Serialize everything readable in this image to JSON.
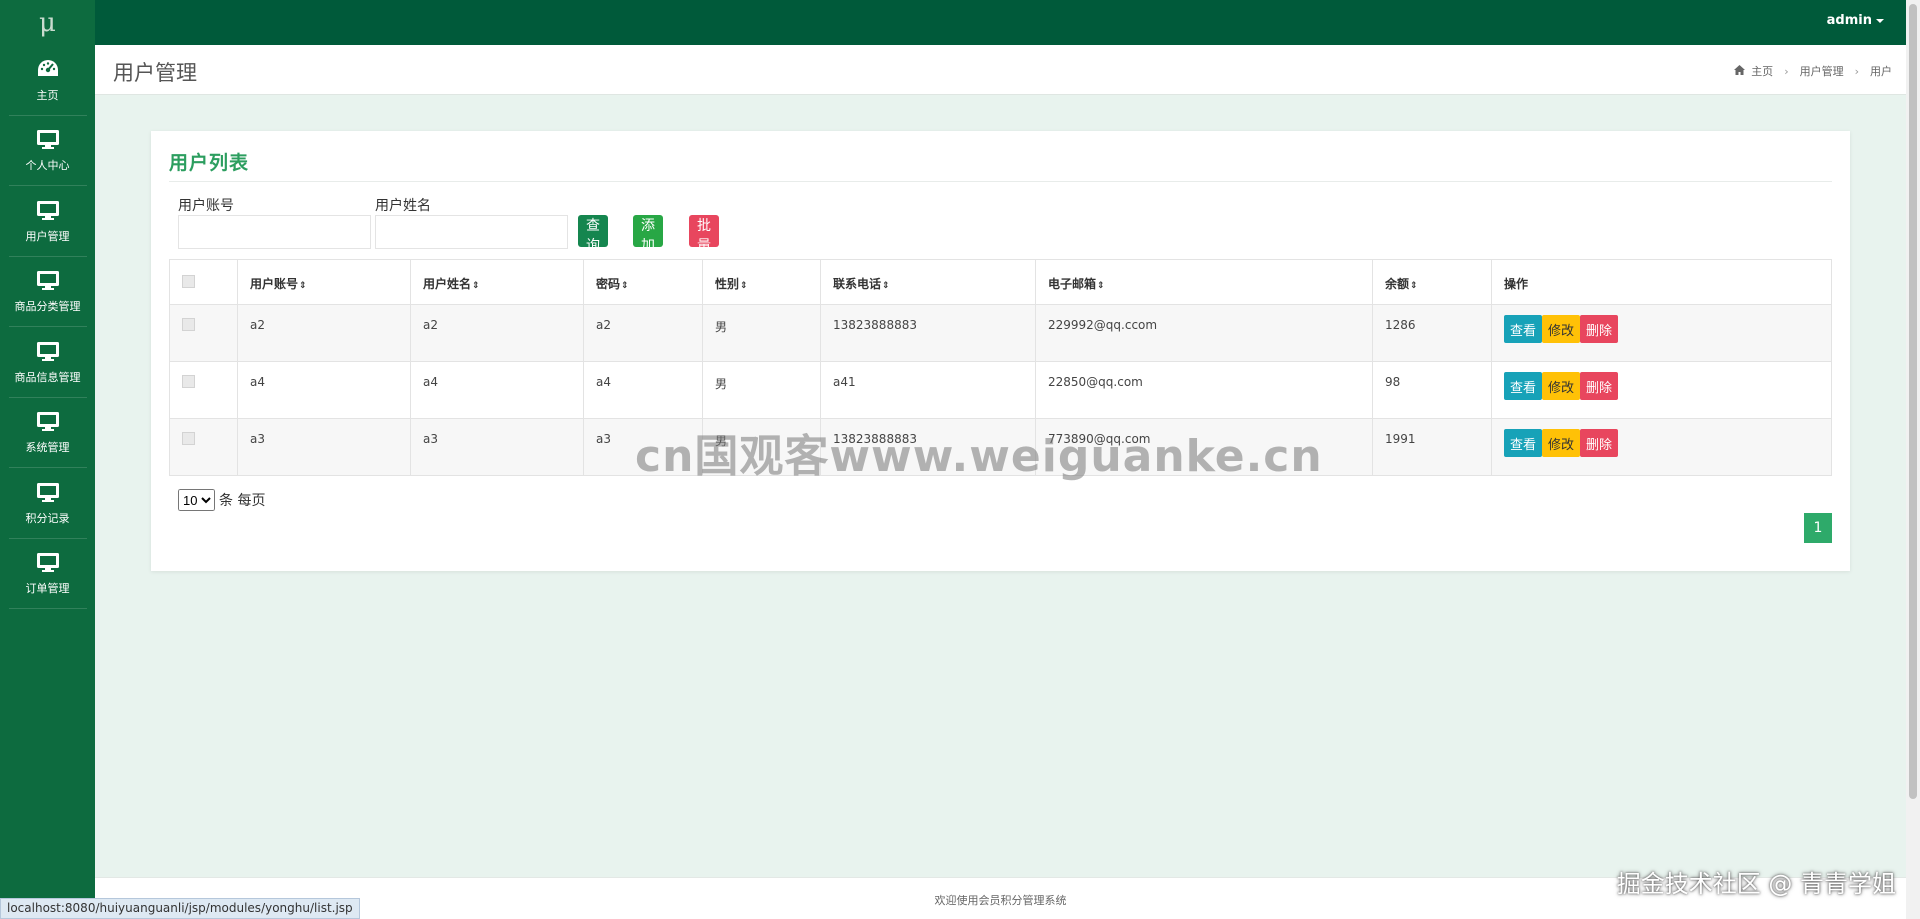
{
  "app": {
    "logo": "μ"
  },
  "sidebar": {
    "items": [
      {
        "label": "主页",
        "icon": "dashboard-icon"
      },
      {
        "label": "个人中心",
        "icon": "monitor-icon"
      },
      {
        "label": "用户管理",
        "icon": "monitor-icon"
      },
      {
        "label": "商品分类管理",
        "icon": "monitor-icon"
      },
      {
        "label": "商品信息管理",
        "icon": "monitor-icon"
      },
      {
        "label": "系统管理",
        "icon": "monitor-icon"
      },
      {
        "label": "积分记录",
        "icon": "monitor-icon"
      },
      {
        "label": "订单管理",
        "icon": "monitor-icon"
      }
    ]
  },
  "topbar": {
    "user": "admin"
  },
  "header": {
    "title": "用户管理",
    "breadcrumb": [
      "主页",
      "用户管理",
      "用户"
    ]
  },
  "card": {
    "title": "用户列表"
  },
  "search": {
    "account_label": "用户账号",
    "name_label": "用户姓名",
    "query_button": "查询",
    "add_button": "添加",
    "batch_delete_button": "批量删除"
  },
  "table": {
    "columns": [
      "用户账号",
      "用户姓名",
      "密码",
      "性别",
      "联系电话",
      "电子邮箱",
      "余额",
      "操作"
    ],
    "rows": [
      {
        "account": "a2",
        "name": "a2",
        "password": "a2",
        "gender": "男",
        "phone": "13823888883",
        "email": "229992@qq.ccom",
        "balance": "1286"
      },
      {
        "account": "a4",
        "name": "a4",
        "password": "a4",
        "gender": "男",
        "phone": "a41",
        "email": "22850@qq.com",
        "balance": "98"
      },
      {
        "account": "a3",
        "name": "a3",
        "password": "a3",
        "gender": "男",
        "phone": "13823888883",
        "email": "773890@qq.com",
        "balance": "1991"
      }
    ],
    "actions": {
      "view": "查看",
      "edit": "修改",
      "delete": "删除"
    }
  },
  "pagination": {
    "page_size": "10",
    "page_size_options": [
      "10"
    ],
    "per_page_label": "条 每页",
    "current_page": "1"
  },
  "footer": {
    "text": "欢迎使用会员积分管理系统"
  },
  "statusbar": {
    "url": "localhost:8080/huiyuanguanli/jsp/modules/yonghu/list.jsp"
  },
  "watermarks": {
    "center": "cn国观客www.weiguanke.cn",
    "corner": "掘金技术社区 @ 青青学姐"
  },
  "colors": {
    "sidebar": "#0d6b3f",
    "topbar": "#005a3a",
    "accent": "#2c9e5f",
    "view": "#17a2b8",
    "edit": "#ffc107",
    "delete": "#e8465e"
  }
}
